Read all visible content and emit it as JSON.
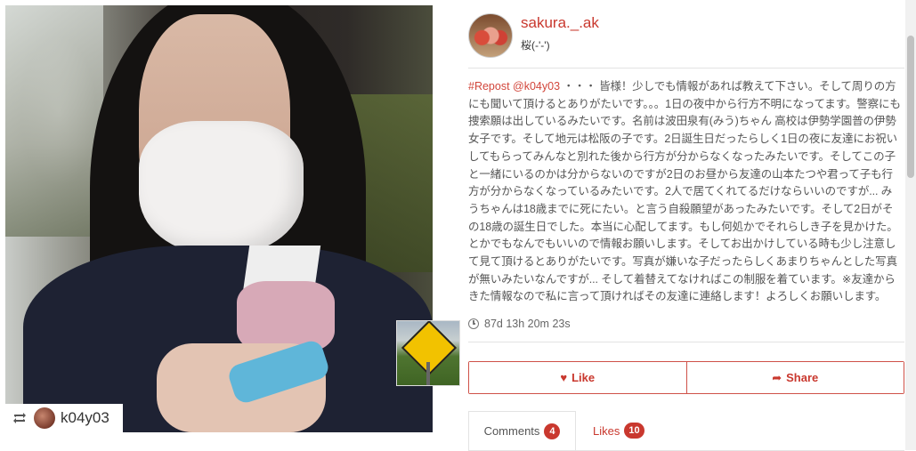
{
  "post": {
    "photo_alt": "",
    "repost": {
      "icon": "repost-icon",
      "username": "k04y03"
    }
  },
  "header": {
    "username": "sakura._.ak",
    "fullname": "桜(-'-')"
  },
  "caption": {
    "tag": "#Repost @k04y03",
    "text": "・・・ 皆様！少しでも情報があれば教えて下さい。そして周りの方にも聞いて頂けるとありがたいです。。。1日の夜中から行方不明になってます。警察にも捜索願は出しているみたいです。名前は波田泉有(みう)ちゃん 高校は伊勢学園普の伊勢女子です。そして地元は松阪の子です。2日誕生日だったらしく1日の夜に友達にお祝いしてもらってみんなと別れた後から行方が分からなくなったみたいです。そしてこの子と一緒にいるのかは分からないのですが2日のお昼から友達の山本たつや君って子も行方が分からなくなっているみたいです。2人で居てくれてるだけならいいのですが... みうちゃんは18歳までに死にたい。と言う自殺願望があったみたいです。そして2日がその18歳の誕生日でした。本当に心配してます。もし何処かでそれらしき子を見かけた。とかでもなんでもいいので情報お願いします。そしてお出かけしている時も少し注意して見て頂けるとありがたいです。写真が嫌いな子だったらしくあまりちゃんとした写真が無いみたいなんですが... そして着替えてなければこの制服を着ています。※友達からきた情報なので私に言って頂ければその友達に連絡します！よろしくお願いします。"
  },
  "timer": {
    "icon": "clock-icon",
    "text": "87d 13h 20m 23s"
  },
  "actions": {
    "like_icon": "heart-icon",
    "like_label": "Like",
    "share_icon": "share-icon",
    "share_label": "Share"
  },
  "tabs": {
    "comments_label": "Comments",
    "comments_count": "4",
    "likes_label": "Likes",
    "likes_count": "10"
  },
  "colors": {
    "accent": "#c9382e",
    "divider": "#e3e3e3"
  }
}
